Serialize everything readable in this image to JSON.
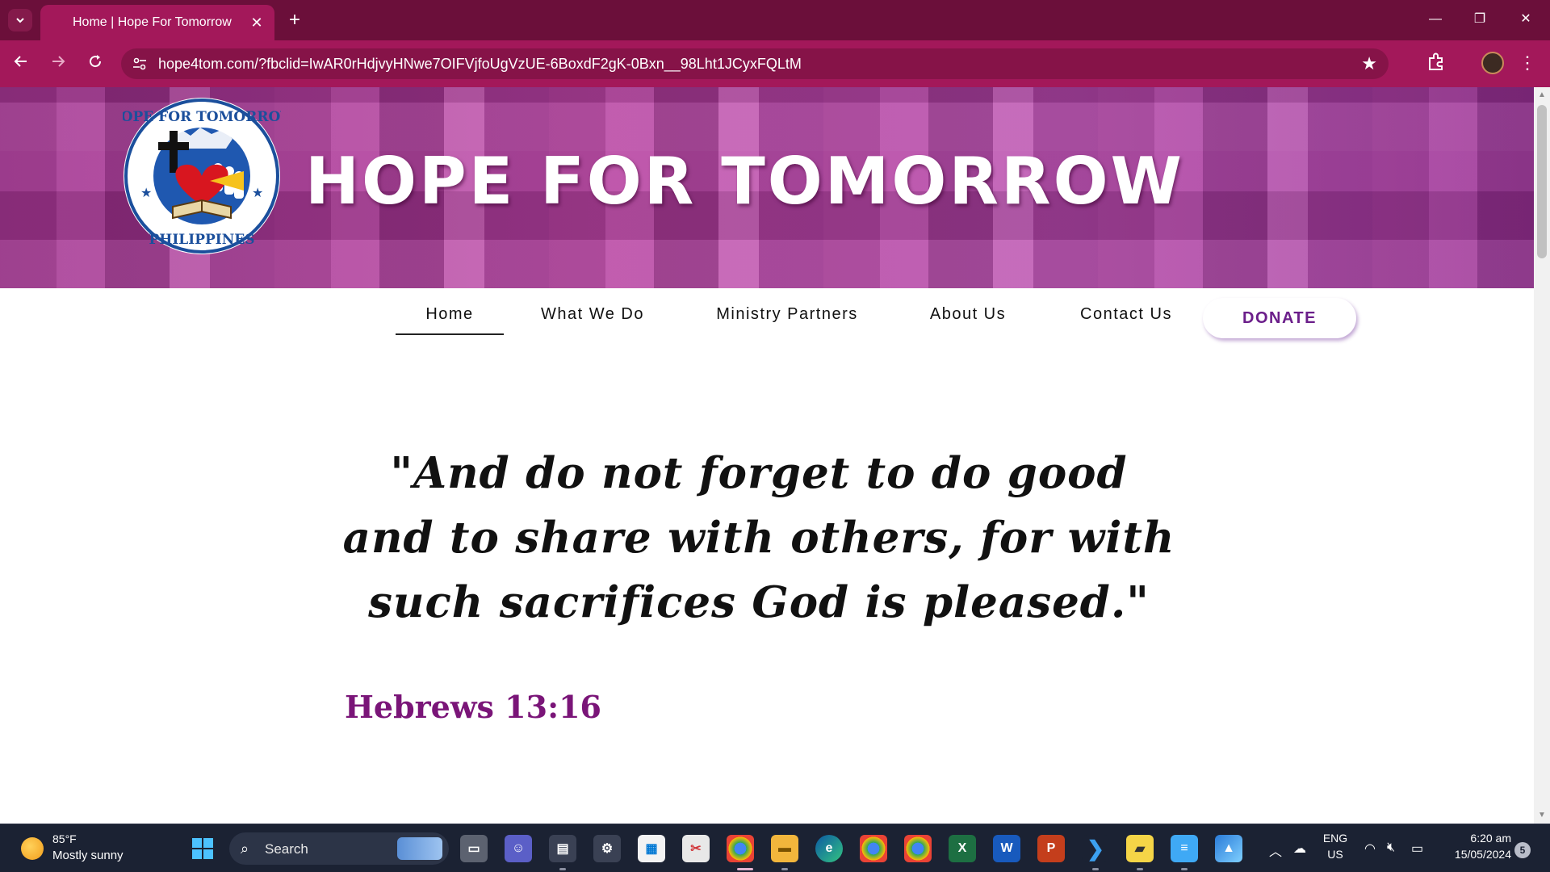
{
  "browser": {
    "tab_title": "Home | Hope For Tomorrow",
    "tab_close": "✕",
    "new_tab": "+",
    "url": "hope4tom.com/?fbclid=IwAR0rHdjvyHNwe7OIFVjfoUgVzUE-6BoxdF2gK-0Bxn__98Lht1JCyxFQLtM",
    "window_controls": {
      "minimize": "—",
      "restore": "❐",
      "close": "✕"
    }
  },
  "site": {
    "title": "HOPE FOR TOMORROW",
    "logo_text": {
      "top": "HOPE FOR TOMORROW",
      "bottom": "PHILIPPINES"
    },
    "nav": [
      {
        "label": "Home",
        "active": true
      },
      {
        "label": "What We Do",
        "active": false
      },
      {
        "label": "Ministry Partners",
        "active": false
      },
      {
        "label": "About Us",
        "active": false
      },
      {
        "label": "Contact Us",
        "active": false
      }
    ],
    "donate_label": "DONATE",
    "quote": "\"And do not forget to do good and to share with others, for with such sacrifices God is pleased.\"",
    "citation": "Hebrews 13:16"
  },
  "taskbar": {
    "weather_temp": "85°F",
    "weather_desc": "Mostly sunny",
    "search_label": "Search",
    "language": "ENG",
    "region": "US",
    "time": "6:20 am",
    "date": "15/05/2024",
    "notification_count": "5",
    "apps": [
      "windows-start",
      "search",
      "task-view",
      "teams-chat",
      "notes-app",
      "settings",
      "microsoft-store",
      "snipping-tool",
      "chrome",
      "file-explorer",
      "edge",
      "chrome-profile-2",
      "chrome-profile-3",
      "excel",
      "word",
      "powerpoint",
      "vscode",
      "sticky-notes",
      "notepad",
      "photos"
    ]
  },
  "colors": {
    "tabstrip": "#6b0f3a",
    "toolbar": "#a3185a",
    "accent_purple": "#7a1578",
    "donate_text": "#6b1e8a",
    "taskbar": "#1b2233"
  }
}
